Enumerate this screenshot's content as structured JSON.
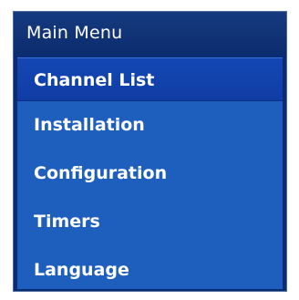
{
  "menu": {
    "title": "Main Menu",
    "items": [
      {
        "label": "Channel List",
        "selected": true
      },
      {
        "label": "Installation",
        "selected": false
      },
      {
        "label": "Configuration",
        "selected": false
      },
      {
        "label": "Timers",
        "selected": false
      },
      {
        "label": "Language",
        "selected": false
      }
    ]
  },
  "colors": {
    "title_bg": "#0c2d6e",
    "list_bg": "#1e5fbe",
    "selected_bg": "#1447b4",
    "text": "#ffffff"
  }
}
